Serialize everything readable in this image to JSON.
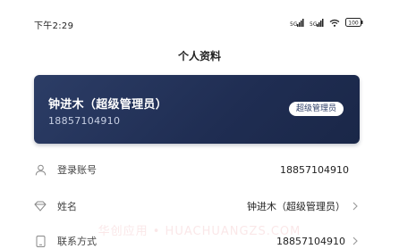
{
  "status_bar": {
    "time": "下午2:29",
    "icons": [
      "signal-icon",
      "signal-icon",
      "wifi-icon",
      "battery-icon"
    ],
    "battery_level": "100"
  },
  "nav": {
    "title": "个人资料"
  },
  "profile_card": {
    "name": "钟进木（超级管理员）",
    "phone": "18857104910",
    "role_badge": "超级管理员",
    "colors": {
      "card_bg": "#24335c",
      "badge_bg": "#ffffff"
    }
  },
  "info_rows": [
    {
      "label": "登录账号",
      "value": "18857104910",
      "icon": "user-icon",
      "has_chevron": false
    },
    {
      "label": "姓名",
      "value": "钟进木（超级管理员）",
      "icon": "diamond-icon",
      "has_chevron": true
    },
    {
      "label": "联系方式",
      "value": "18857104910",
      "icon": "phone-icon",
      "has_chevron": true
    }
  ],
  "watermark": "华创应用 • HUACHUANGZS.COM"
}
